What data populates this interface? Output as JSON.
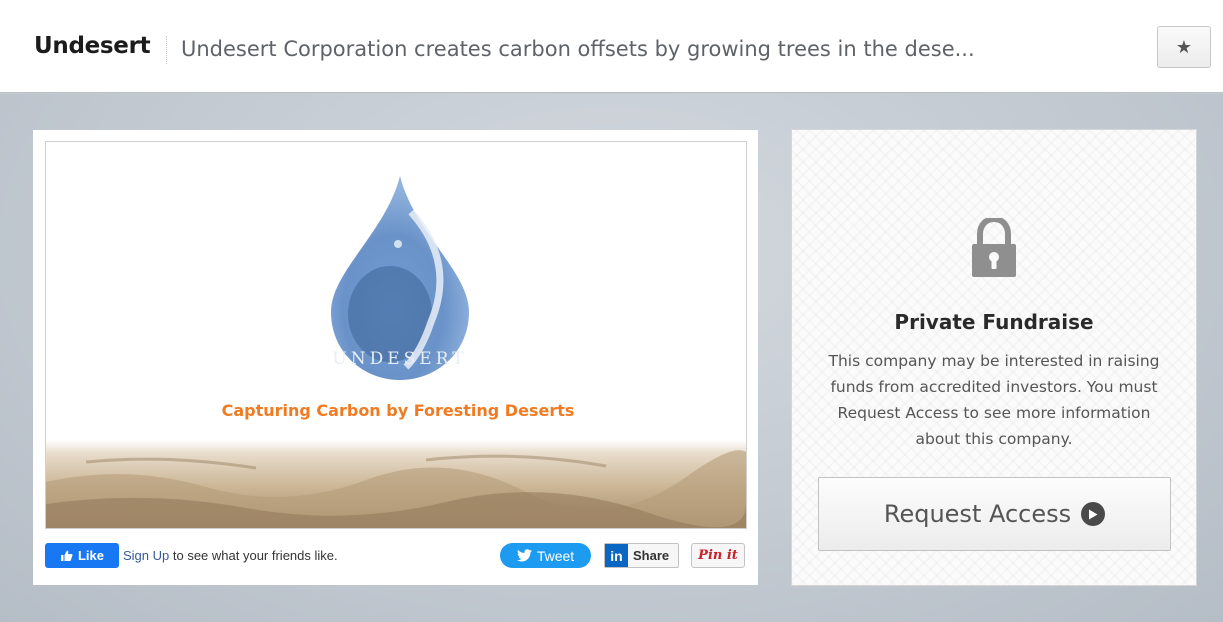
{
  "header": {
    "company_name": "Undesert",
    "tagline": "Undesert Corporation creates carbon offsets by growing trees in the dese...",
    "star_icon": "★"
  },
  "media": {
    "logo_wordmark": "UNDESERT",
    "slogan": "Capturing Carbon by Foresting Deserts",
    "slogan_color": "#f07b22",
    "drop_color": "#4f7fbf"
  },
  "social": {
    "fb_like_label": "Like",
    "fb_signup_link": "Sign Up",
    "fb_signup_text": " to see what your friends like.",
    "tweet_label": "Tweet",
    "linkedin_logo": "in",
    "linkedin_label": "Share",
    "pin_label": "Pin it"
  },
  "fundraise": {
    "title": "Private Fundraise",
    "description": "This company may be interested in raising funds from accredited investors. You must Request Access to see more information about this company.",
    "button_label": "Request Access"
  }
}
